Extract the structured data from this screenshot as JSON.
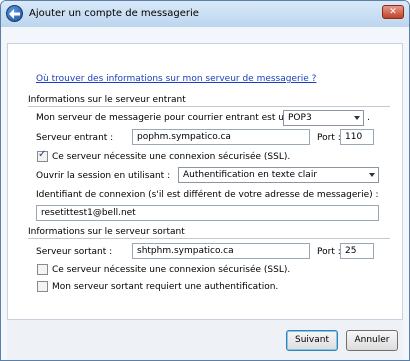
{
  "window": {
    "title": "Ajouter un compte de messagerie"
  },
  "help_link": "Où trouver des informations sur mon serveur de messagerie ?",
  "incoming": {
    "section_title": "Informations sur le serveur entrant",
    "type_label": "Mon serveur de messagerie pour courrier entrant est un serveur",
    "type_value": "POP3",
    "type_suffix": ".",
    "server_label": "Serveur entrant :",
    "server_value": "pophm.sympatico.ca",
    "port_label": "Port :",
    "port_value": "110",
    "ssl_label": "Ce serveur nécessite une connexion sécurisée (SSL).",
    "ssl_checked": true,
    "login_label": "Ouvrir la session en utilisant :",
    "login_value": "Authentification en texte clair",
    "id_label": "Identifiant de connexion (s'il est différent de votre adresse de messagerie) :",
    "id_value": "resetittest1@bell.net"
  },
  "outgoing": {
    "section_title": "Informations sur le serveur sortant",
    "server_label": "Serveur sortant :",
    "server_value": "shtphm.sympatico.ca",
    "port_label": "Port :",
    "port_value": "25",
    "ssl_label": "Ce serveur nécessite une connexion sécurisée (SSL).",
    "ssl_checked": false,
    "auth_label": "Mon serveur sortant requiert une authentification.",
    "auth_checked": false
  },
  "buttons": {
    "next": "Suivant",
    "cancel": "Annuler"
  },
  "colors": {
    "link": "#1a3fbf",
    "title_bar": "#c8dcf2",
    "footer": "#eef1f5"
  }
}
